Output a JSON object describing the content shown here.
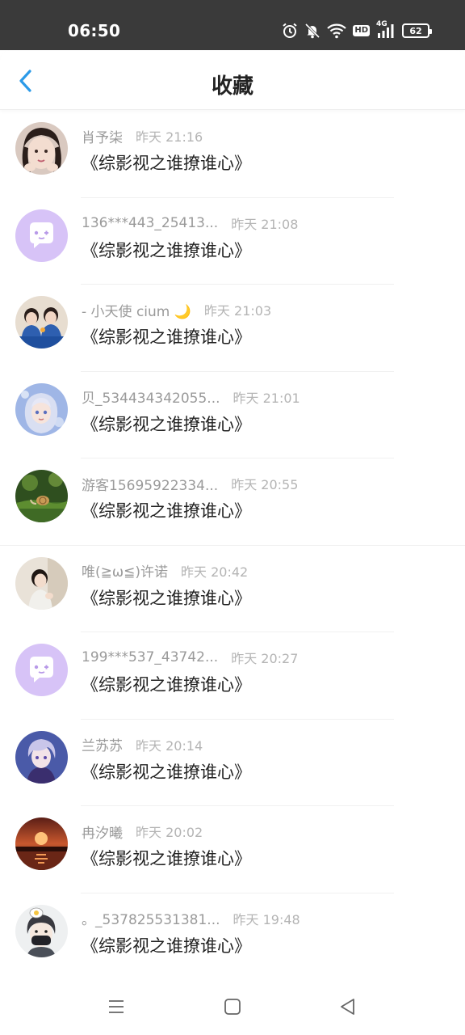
{
  "status_bar": {
    "time": "06:50",
    "hd_label": "HD",
    "network_label": "4G",
    "battery_level": "62",
    "icons": [
      "alarm-icon",
      "bell-muted-icon",
      "wifi-icon",
      "hd-badge",
      "signal-4g-icon",
      "battery-icon"
    ]
  },
  "header": {
    "back_icon": "chevron-left-icon",
    "title": "收藏"
  },
  "colors": {
    "accent": "#2b9ae8",
    "status_bar_bg": "#3a3a3a",
    "user_text": "#9a9a9a",
    "time_text": "#b4b4b4",
    "title_text": "#222222"
  },
  "items": [
    {
      "user": "肖予柒",
      "time": "昨天 21:16",
      "title": "《综影视之谁撩谁心》",
      "avatar": "portrait-avatar"
    },
    {
      "user": "136***443_25413...",
      "time": "昨天 21:08",
      "title": "《综影视之谁撩谁心》",
      "avatar": "default-chat-avatar"
    },
    {
      "user": "- 小天使 cium 🌙",
      "time": "昨天 21:03",
      "title": "《综影视之谁撩谁心》",
      "avatar": "friends-photo-avatar"
    },
    {
      "user": "贝_534434342055...",
      "time": "昨天 21:01",
      "title": "《综影视之谁撩谁心》",
      "avatar": "anime-girl-avatar"
    },
    {
      "user": "游客15695922334...",
      "time": "昨天 20:55",
      "title": "《综影视之谁撩谁心》",
      "avatar": "nature-snail-avatar"
    },
    {
      "user": "唯(≧ω≦)许诺",
      "time": "昨天 20:42",
      "title": "《综影视之谁撩谁心》",
      "avatar": "girl-photo-avatar"
    },
    {
      "user": "199***537_43742...",
      "time": "昨天 20:27",
      "title": "《综影视之谁撩谁心》",
      "avatar": "default-chat-avatar"
    },
    {
      "user": "兰苏苏",
      "time": "昨天 20:14",
      "title": "《综影视之谁撩谁心》",
      "avatar": "anime-boy-avatar"
    },
    {
      "user": "冉汐曦",
      "time": "昨天 20:02",
      "title": "《综影视之谁撩谁心》",
      "avatar": "sunset-avatar"
    },
    {
      "user": "。_537825531381...",
      "time": "昨天 19:48",
      "title": "《综影视之谁撩谁心》",
      "avatar": "cartoon-mask-avatar"
    }
  ],
  "nav_bar": {
    "icons": [
      "menu-icon",
      "home-icon",
      "back-icon"
    ]
  }
}
